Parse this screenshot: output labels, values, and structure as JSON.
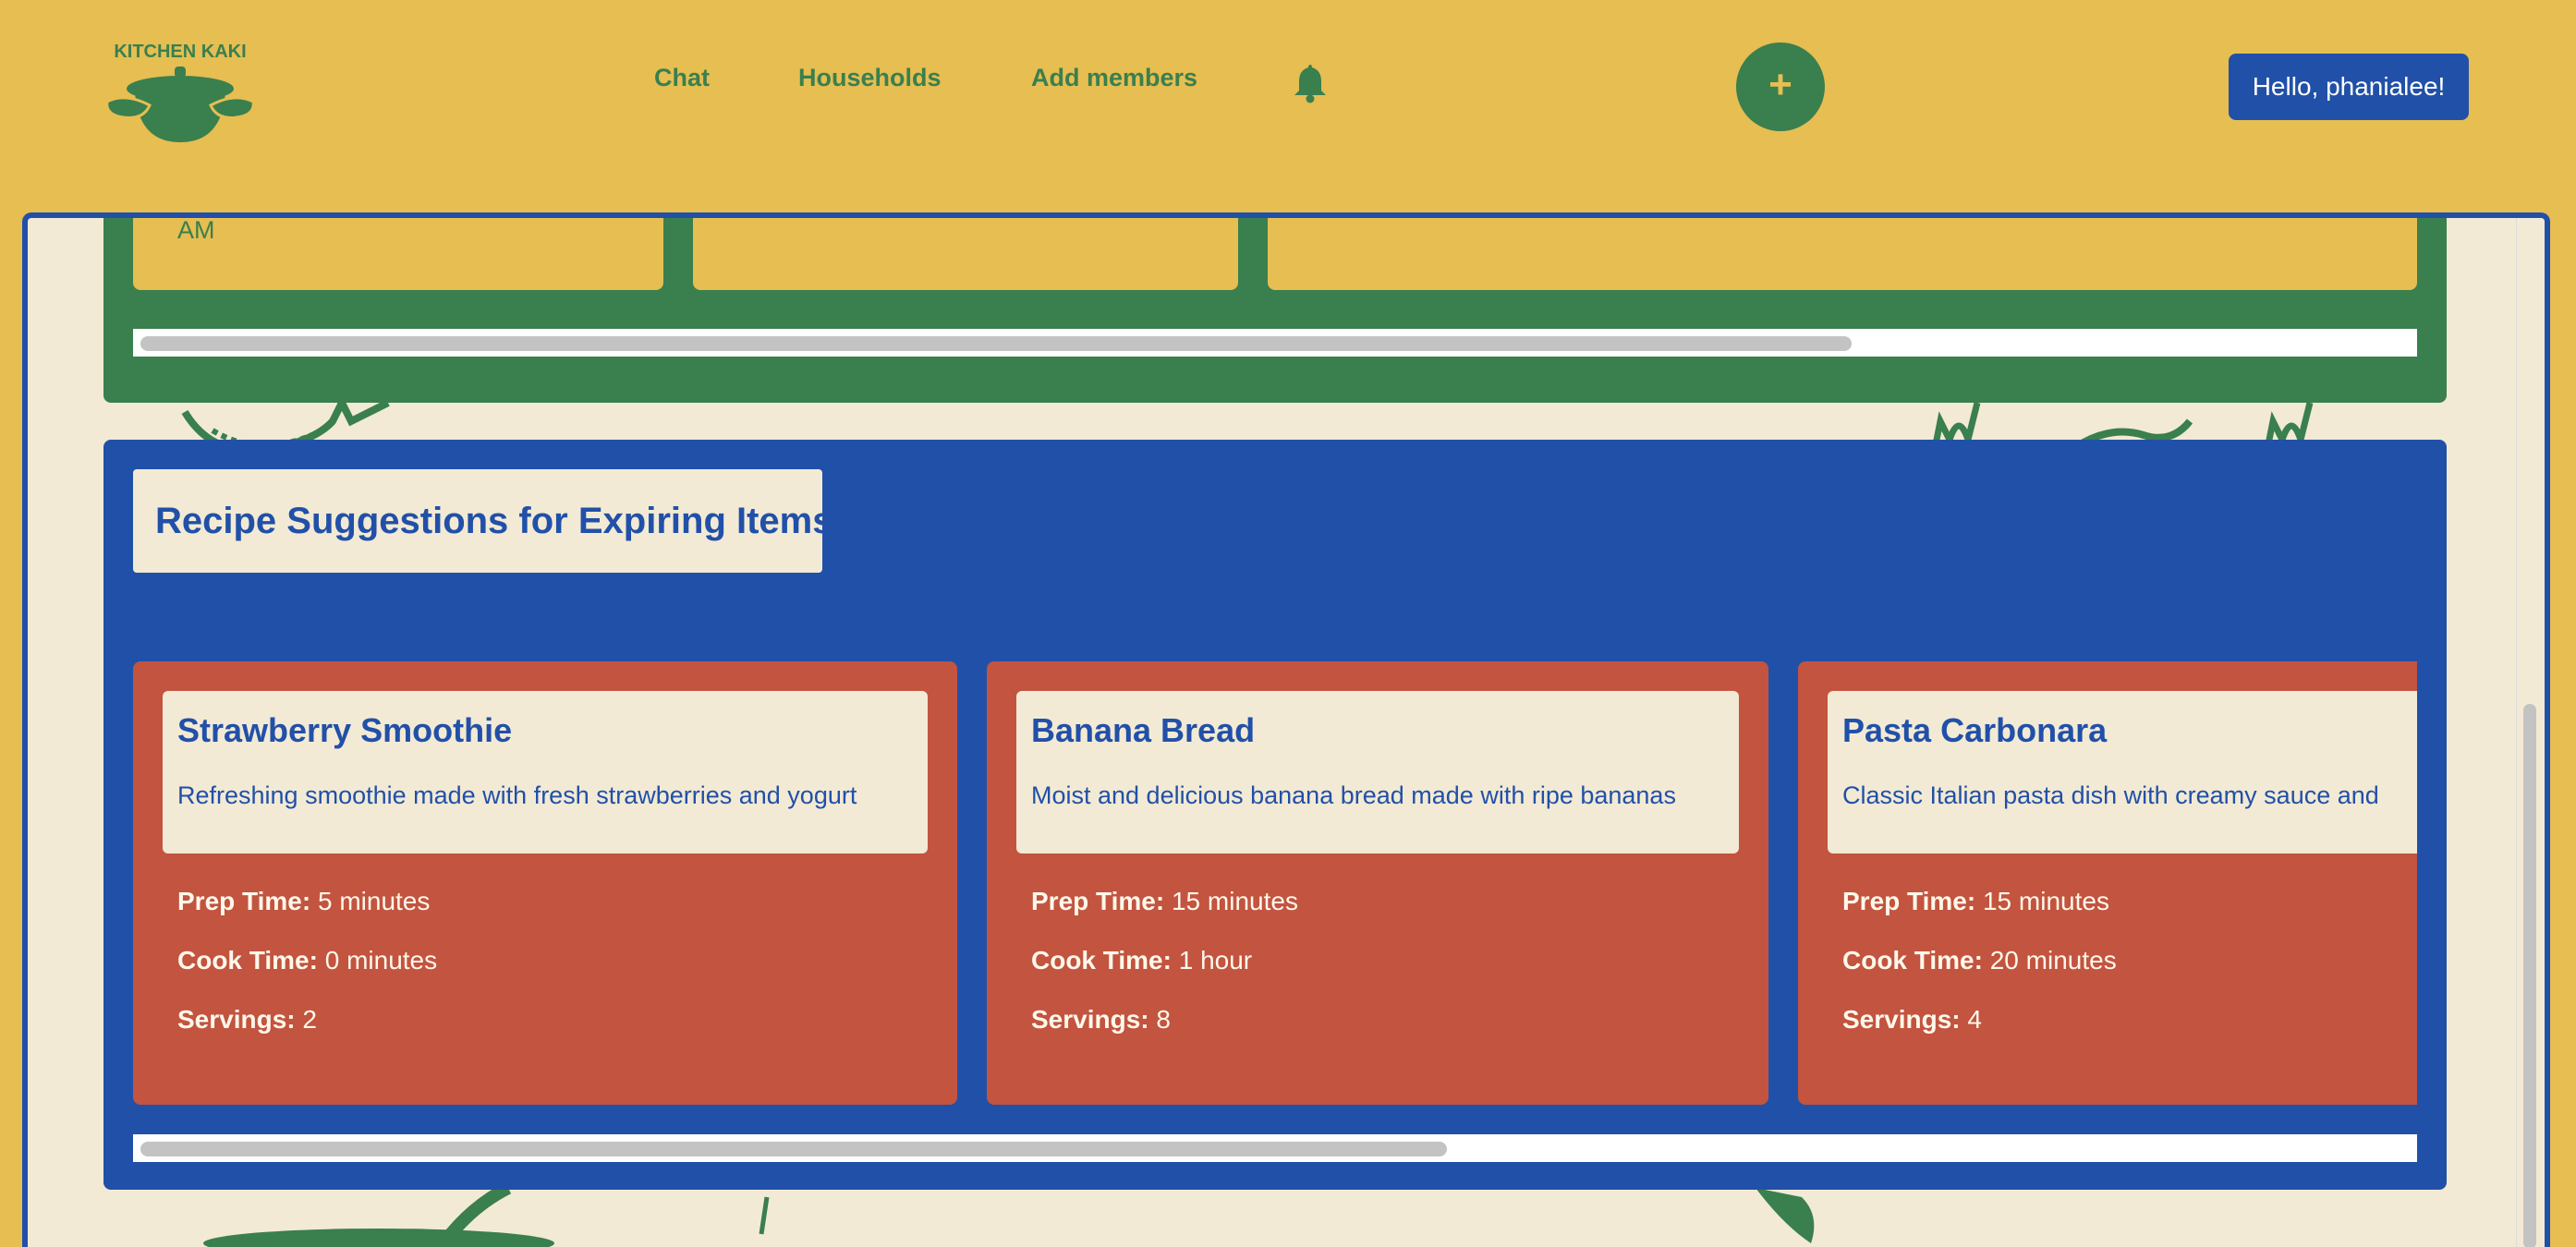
{
  "header": {
    "logo_text": "KITCHEN KAKI",
    "nav": [
      {
        "label": "Chat"
      },
      {
        "label": "Households"
      },
      {
        "label": "Add members"
      }
    ],
    "bell_icon": "bell-icon",
    "add_label": "+",
    "greeting": "Hello, phanialee!"
  },
  "inventory_panel": {
    "cards": [
      {
        "text": "AM"
      },
      {
        "text": ""
      },
      {
        "text": ""
      }
    ]
  },
  "recipes": {
    "title": "Recipe Suggestions for Expiring Items",
    "prep_label": "Prep Time:",
    "cook_label": "Cook Time:",
    "servings_label": "Servings:",
    "items": [
      {
        "name": "Strawberry Smoothie",
        "description": "Refreshing smoothie made with fresh strawberries and yogurt",
        "prep": "5 minutes",
        "cook": "0 minutes",
        "servings": "2"
      },
      {
        "name": "Banana Bread",
        "description": "Moist and delicious banana bread made with ripe bananas",
        "prep": "15 minutes",
        "cook": "1 hour",
        "servings": "8"
      },
      {
        "name": "Pasta Carbonara",
        "description": "Classic Italian pasta dish with creamy sauce and",
        "prep": "15 minutes",
        "cook": "20 minutes",
        "servings": "4"
      }
    ]
  },
  "colors": {
    "mustard": "#E6BE52",
    "green": "#3A7F4E",
    "blue": "#2150A8",
    "cream": "#F2EAD5",
    "terracotta": "#C25440"
  }
}
